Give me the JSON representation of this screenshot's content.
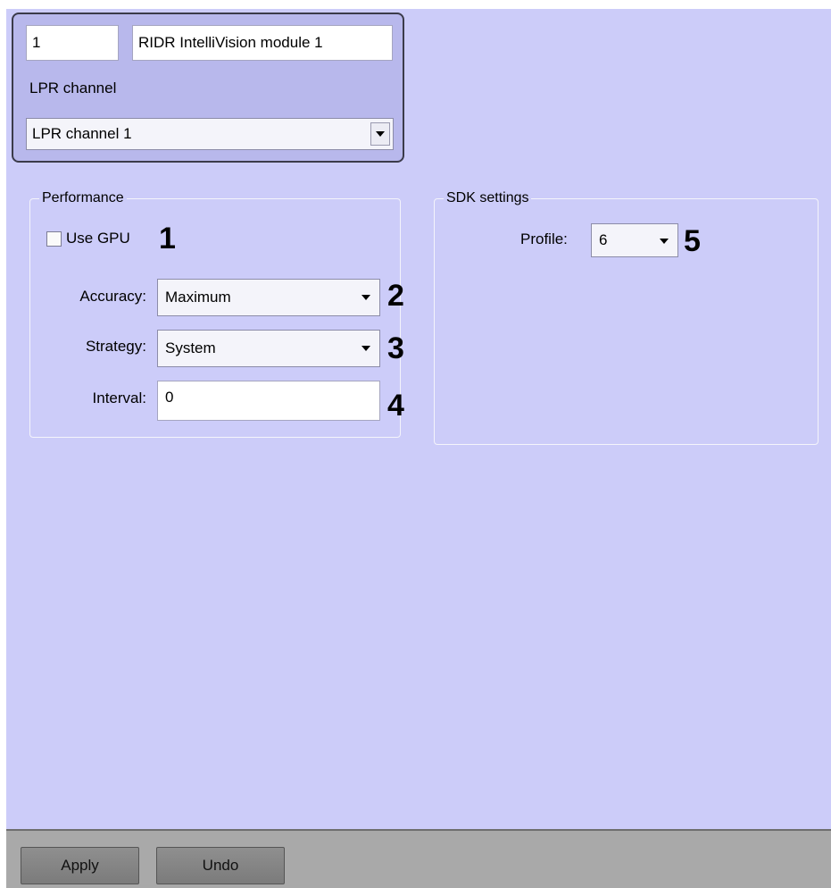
{
  "header": {
    "id_value": "1",
    "name_value": "RIDR IntelliVision module 1",
    "lpr_channel_label": "LPR channel",
    "lpr_channel_selected": "LPR channel 1"
  },
  "performance": {
    "title": "Performance",
    "use_gpu_label": "Use GPU",
    "use_gpu_checked": false,
    "accuracy_label": "Accuracy:",
    "accuracy_value": "Maximum",
    "strategy_label": "Strategy:",
    "strategy_value": "System",
    "interval_label": "Interval:",
    "interval_value": "0"
  },
  "sdk": {
    "title": "SDK settings",
    "profile_label": "Profile:",
    "profile_value": "6"
  },
  "callouts": [
    "1",
    "2",
    "3",
    "4",
    "5"
  ],
  "footer": {
    "apply_label": "Apply",
    "undo_label": "Undo"
  },
  "colors": {
    "panel_bg": "#ccccf9",
    "header_bg": "#b8b8ec",
    "footer_bg": "#a9a9a9"
  }
}
